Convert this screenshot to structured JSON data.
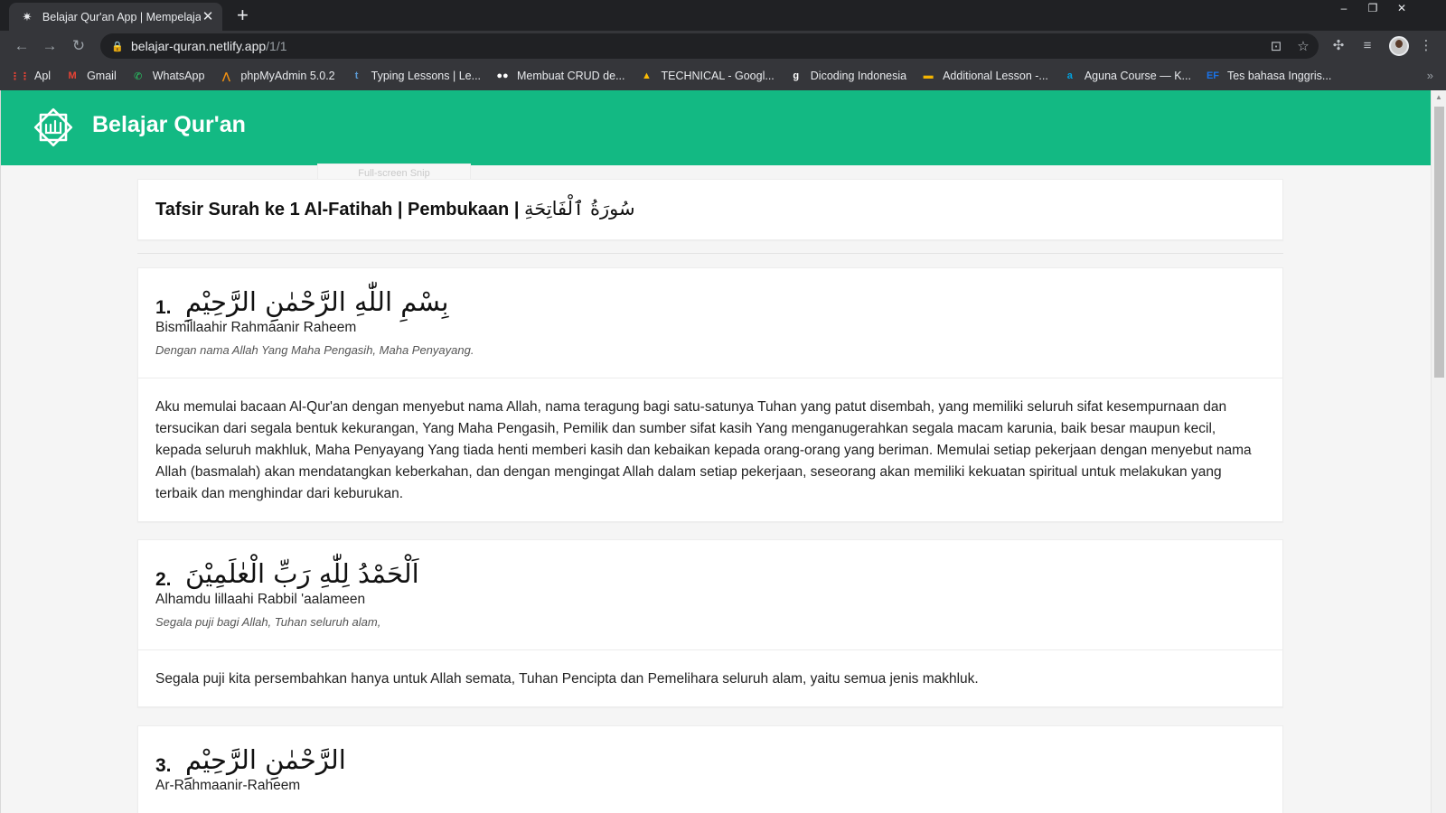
{
  "browser": {
    "tab_title": "Belajar Qur'an App | Mempelajari",
    "tab_close": "✕",
    "new_tab": "+",
    "url_host": "belajar-quran.netlify.app",
    "url_path": "/1/1",
    "window_controls": {
      "minimize": "–",
      "restore": "❐",
      "close": "✕"
    }
  },
  "bookmarks": [
    {
      "label": "Apl",
      "icon": "apps-grid-icon",
      "color": "#ea4335"
    },
    {
      "label": "Gmail",
      "icon": "gmail-icon",
      "color": "#ea4335"
    },
    {
      "label": "WhatsApp",
      "icon": "whatsapp-icon",
      "color": "#25d366"
    },
    {
      "label": "phpMyAdmin 5.0.2",
      "icon": "phpmyadmin-icon",
      "color": "#f29111"
    },
    {
      "label": "Typing Lessons | Le...",
      "icon": "typing-icon",
      "color": "#5b9bd5"
    },
    {
      "label": "Membuat CRUD de...",
      "icon": "medium-icon",
      "color": "#ffffff"
    },
    {
      "label": "TECHNICAL - Googl...",
      "icon": "google-drive-icon",
      "color": "#fbbc04"
    },
    {
      "label": "Dicoding Indonesia",
      "icon": "dicoding-icon",
      "color": "#ffffff"
    },
    {
      "label": "Additional Lesson -...",
      "icon": "slides-icon",
      "color": "#f4b400"
    },
    {
      "label": "Aguna Course — K...",
      "icon": "aguna-icon",
      "color": "#00a3e0"
    },
    {
      "label": "Tes bahasa Inggris...",
      "icon": "ef-icon",
      "color": "#1a73e8"
    }
  ],
  "app": {
    "brand": "Belajar Qur'an",
    "accent": "#13b983",
    "snip_label": "Full-screen Snip"
  },
  "surah": {
    "title_latin": "Tafsir Surah ke 1 Al-Fatihah | Pembukaan | ",
    "title_arabic": "سُورَةُ ٱلْفَاتِحَةِ"
  },
  "ayahs": [
    {
      "number": "1.",
      "arabic": "بِسْمِ اللّٰهِ الرَّحْمٰنِ الرَّحِيْمِ",
      "latin": "Bismillaahir Rahmaanir Raheem",
      "translation": "Dengan nama Allah Yang Maha Pengasih, Maha Penyayang.",
      "tafsir": "Aku memulai bacaan Al-Qur'an dengan menyebut nama Allah, nama teragung bagi satu-satunya Tuhan yang patut disembah, yang memiliki seluruh sifat kesempurnaan dan tersucikan dari segala bentuk kekurangan, Yang Maha Pengasih, Pemilik dan sumber sifat kasih Yang menganugerahkan segala macam karunia, baik besar maupun kecil, kepada seluruh makhluk, Maha Penyayang Yang tiada henti memberi kasih dan kebaikan kepada orang-orang yang beriman. Memulai setiap pekerjaan dengan menyebut nama Allah (basmalah) akan mendatangkan keberkahan, dan dengan mengingat Allah dalam setiap pekerjaan, seseorang akan memiliki kekuatan spiritual untuk melakukan yang terbaik dan menghindar dari keburukan."
    },
    {
      "number": "2.",
      "arabic": "اَلْحَمْدُ لِلّٰهِ رَبِّ الْعٰلَمِيْنَ",
      "latin": "Alhamdu lillaahi Rabbil 'aalameen",
      "translation": "Segala puji bagi Allah, Tuhan seluruh alam,",
      "tafsir": "Segala puji kita persembahkan hanya untuk Allah semata, Tuhan Pencipta dan Pemelihara seluruh alam, yaitu semua jenis makhluk."
    },
    {
      "number": "3.",
      "arabic": "الرَّحْمٰنِ الرَّحِيْمِ",
      "latin": "Ar-Rahmaanir-Raheem",
      "translation": "",
      "tafsir": ""
    }
  ]
}
